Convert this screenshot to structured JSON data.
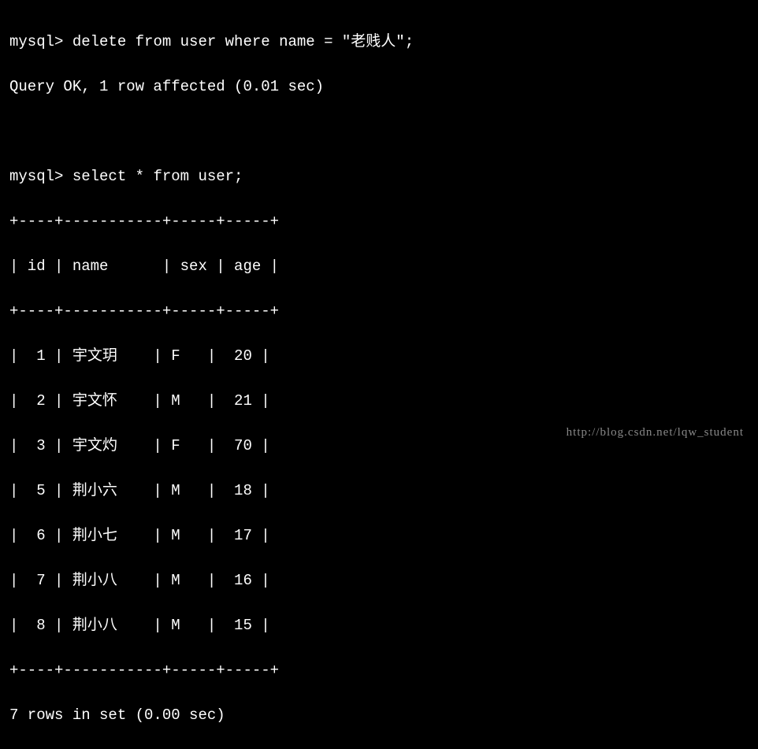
{
  "prompt": "mysql>",
  "commands": {
    "delete": "delete from user where name = \"老贱人\";",
    "delete_result": "Query OK, 1 row affected (0.01 sec)",
    "select": "select * from user;"
  },
  "table": {
    "border_top": "+----+-----------+-----+-----+",
    "header": "| id | name      | sex | age |",
    "border_mid": "+----+-----------+-----+-----+",
    "rows": [
      "|  1 | 宇文玥    | F   |  20 |",
      "|  2 | 宇文怀    | M   |  21 |",
      "|  3 | 宇文灼    | F   |  70 |",
      "|  5 | 荆小六    | M   |  18 |",
      "|  6 | 荆小七    | M   |  17 |",
      "|  7 | 荆小八    | M   |  16 |",
      "|  8 | 荆小八    | M   |  15 |"
    ],
    "border_bot": "+----+-----------+-----+-----+",
    "footer": "7 rows in set (0.00 sec)"
  },
  "chart_data": {
    "type": "table",
    "columns": [
      "id",
      "name",
      "sex",
      "age"
    ],
    "data": [
      {
        "id": 1,
        "name": "宇文玥",
        "sex": "F",
        "age": 20
      },
      {
        "id": 2,
        "name": "宇文怀",
        "sex": "M",
        "age": 21
      },
      {
        "id": 3,
        "name": "宇文灼",
        "sex": "F",
        "age": 70
      },
      {
        "id": 5,
        "name": "荆小六",
        "sex": "M",
        "age": 18
      },
      {
        "id": 6,
        "name": "荆小七",
        "sex": "M",
        "age": 17
      },
      {
        "id": 7,
        "name": "荆小八",
        "sex": "M",
        "age": 16
      },
      {
        "id": 8,
        "name": "荆小八",
        "sex": "M",
        "age": 15
      }
    ],
    "row_count": 7,
    "query_time_sec": 0.0
  },
  "watermark": "http://blog.csdn.net/lqw_student"
}
